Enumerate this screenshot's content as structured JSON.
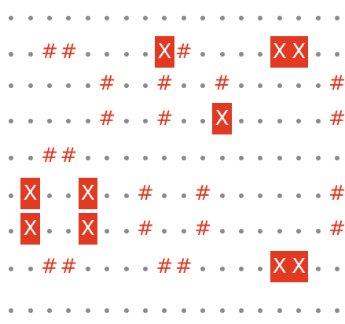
{
  "legend": {
    "dot": ".",
    "wall": "#",
    "marker": "X"
  },
  "colors": {
    "background": "#ffffff",
    "dot": "#8a8a8a",
    "wall": "#e23a22",
    "marker_bg": "#e23a22",
    "marker_text": "#ffffff"
  },
  "grid": [
    "..................",
    "..##....X#....XX..",
    ".....#..#..#.....#",
    ".....#..#..X.....#",
    "..##..............",
    ".X..X..#..#......#",
    ".X..X..#..#......#",
    "..##....##....XX..",
    ".................."
  ]
}
